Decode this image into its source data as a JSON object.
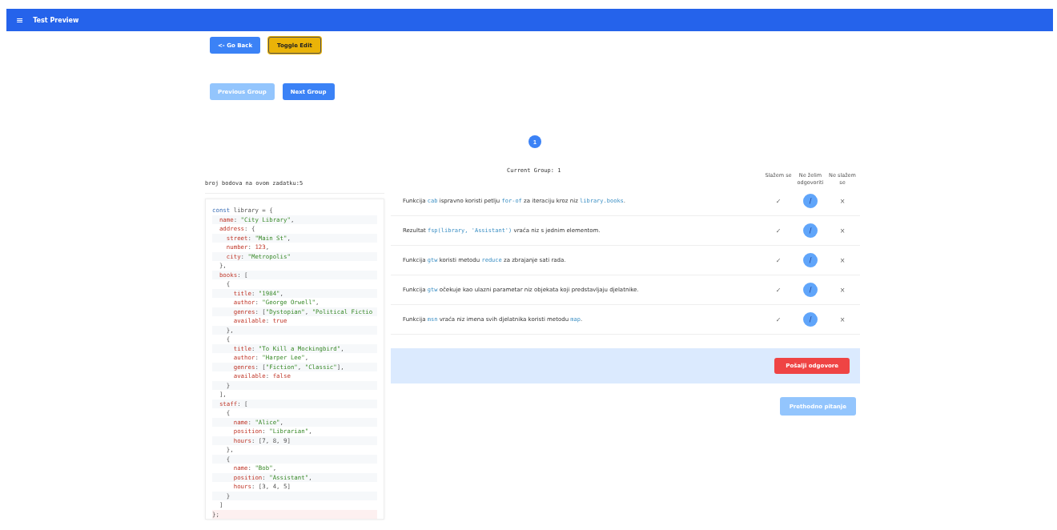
{
  "header": {
    "menu_icon": "≡",
    "title": "Test Preview"
  },
  "top_buttons": [
    {
      "label": "<- Go Back",
      "kind": "primary"
    },
    {
      "label": "Toggle Edit",
      "kind": "warning"
    }
  ],
  "group_nav": [
    {
      "label": "Previous Group",
      "disabled": true
    },
    {
      "label": "Next Group",
      "disabled": false
    }
  ],
  "pages": [
    {
      "label": "1",
      "selected": true
    }
  ],
  "current_group": "Current Group: 1",
  "points": "broj bodova na ovom zadatku:5",
  "code_lines": [
    [
      {
        "kind": "keyword",
        "text": "const "
      },
      {
        "kind": "plain",
        "text": "library = {"
      }
    ],
    [
      {
        "kind": "key",
        "text": "  name"
      },
      {
        "kind": "plain",
        "text": ": "
      },
      {
        "kind": "string",
        "text": "\"City Library\""
      },
      {
        "kind": "plain",
        "text": ","
      }
    ],
    [
      {
        "kind": "key",
        "text": "  address"
      },
      {
        "kind": "plain",
        "text": ": {"
      }
    ],
    [
      {
        "kind": "key",
        "text": "    street"
      },
      {
        "kind": "plain",
        "text": ": "
      },
      {
        "kind": "string",
        "text": "\"Main St\""
      },
      {
        "kind": "plain",
        "text": ","
      }
    ],
    [
      {
        "kind": "key",
        "text": "    number"
      },
      {
        "kind": "plain",
        "text": ": "
      },
      {
        "kind": "number",
        "text": "123"
      },
      {
        "kind": "plain",
        "text": ","
      }
    ],
    [
      {
        "kind": "key",
        "text": "    city"
      },
      {
        "kind": "plain",
        "text": ": "
      },
      {
        "kind": "string",
        "text": "\"Metropolis\""
      }
    ],
    [
      {
        "kind": "plain",
        "text": "  },"
      }
    ],
    [
      {
        "kind": "key",
        "text": "  books"
      },
      {
        "kind": "plain",
        "text": ": ["
      }
    ],
    [
      {
        "kind": "plain",
        "text": "    {"
      }
    ],
    [
      {
        "kind": "key",
        "text": "      title"
      },
      {
        "kind": "plain",
        "text": ": "
      },
      {
        "kind": "string",
        "text": "\"1984\""
      },
      {
        "kind": "plain",
        "text": ","
      }
    ],
    [
      {
        "kind": "key",
        "text": "      author"
      },
      {
        "kind": "plain",
        "text": ": "
      },
      {
        "kind": "string",
        "text": "\"George Orwell\""
      },
      {
        "kind": "plain",
        "text": ","
      }
    ],
    [
      {
        "kind": "key",
        "text": "      genres"
      },
      {
        "kind": "plain",
        "text": ": ["
      },
      {
        "kind": "string",
        "text": "\"Dystopian\""
      },
      {
        "kind": "plain",
        "text": ", "
      },
      {
        "kind": "string",
        "text": "\"Political Fictio"
      }
    ],
    [
      {
        "kind": "key",
        "text": "      available"
      },
      {
        "kind": "plain",
        "text": ": "
      },
      {
        "kind": "number",
        "text": "true"
      }
    ],
    [
      {
        "kind": "plain",
        "text": "    },"
      }
    ],
    [
      {
        "kind": "plain",
        "text": "    {"
      }
    ],
    [
      {
        "kind": "key",
        "text": "      title"
      },
      {
        "kind": "plain",
        "text": ": "
      },
      {
        "kind": "string",
        "text": "\"To Kill a Mockingbird\""
      },
      {
        "kind": "plain",
        "text": ","
      }
    ],
    [
      {
        "kind": "key",
        "text": "      author"
      },
      {
        "kind": "plain",
        "text": ": "
      },
      {
        "kind": "string",
        "text": "\"Harper Lee\""
      },
      {
        "kind": "plain",
        "text": ","
      }
    ],
    [
      {
        "kind": "key",
        "text": "      genres"
      },
      {
        "kind": "plain",
        "text": ": ["
      },
      {
        "kind": "string",
        "text": "\"Fiction\""
      },
      {
        "kind": "plain",
        "text": ", "
      },
      {
        "kind": "string",
        "text": "\"Classic\""
      },
      {
        "kind": "plain",
        "text": "],"
      }
    ],
    [
      {
        "kind": "key",
        "text": "      available"
      },
      {
        "kind": "plain",
        "text": ": "
      },
      {
        "kind": "number",
        "text": "false"
      }
    ],
    [
      {
        "kind": "plain",
        "text": "    }"
      }
    ],
    [
      {
        "kind": "plain",
        "text": "  ],"
      }
    ],
    [
      {
        "kind": "key",
        "text": "  staff"
      },
      {
        "kind": "plain",
        "text": ": ["
      }
    ],
    [
      {
        "kind": "plain",
        "text": "    {"
      }
    ],
    [
      {
        "kind": "key",
        "text": "      name"
      },
      {
        "kind": "plain",
        "text": ": "
      },
      {
        "kind": "string",
        "text": "\"Alice\""
      },
      {
        "kind": "plain",
        "text": ","
      }
    ],
    [
      {
        "kind": "key",
        "text": "      position"
      },
      {
        "kind": "plain",
        "text": ": "
      },
      {
        "kind": "string",
        "text": "\"Librarian\""
      },
      {
        "kind": "plain",
        "text": ","
      }
    ],
    [
      {
        "kind": "key",
        "text": "      hours"
      },
      {
        "kind": "plain",
        "text": ": [7, 8, 9]"
      }
    ],
    [
      {
        "kind": "plain",
        "text": "    },"
      }
    ],
    [
      {
        "kind": "plain",
        "text": "    {"
      }
    ],
    [
      {
        "kind": "key",
        "text": "      name"
      },
      {
        "kind": "plain",
        "text": ": "
      },
      {
        "kind": "string",
        "text": "\"Bob\""
      },
      {
        "kind": "plain",
        "text": ","
      }
    ],
    [
      {
        "kind": "key",
        "text": "      position"
      },
      {
        "kind": "plain",
        "text": ": "
      },
      {
        "kind": "string",
        "text": "\"Assistant\""
      },
      {
        "kind": "plain",
        "text": ","
      }
    ],
    [
      {
        "kind": "key",
        "text": "      hours"
      },
      {
        "kind": "plain",
        "text": ": [3, 4, 5]"
      }
    ],
    [
      {
        "kind": "plain",
        "text": "    }"
      }
    ],
    [
      {
        "kind": "plain",
        "text": "  ]"
      }
    ],
    [
      {
        "kind": "plain",
        "text": "};"
      }
    ]
  ],
  "answer_columns": [
    "Slažem se",
    "Ne želim odgovoriti",
    "Ne slažem se"
  ],
  "statements": [
    {
      "parts": [
        {
          "text": "Funkcija "
        },
        {
          "text": "cab",
          "code": true
        },
        {
          "text": " ispravno koristi petlju "
        },
        {
          "text": "for-of",
          "code": true
        },
        {
          "text": " za iteraciju kroz niz "
        },
        {
          "text": "library.books",
          "code": true
        },
        {
          "text": "."
        }
      ],
      "options": [
        {
          "symbol": "✓",
          "selected": false
        },
        {
          "symbol": "/",
          "selected": true
        },
        {
          "symbol": "×",
          "selected": false
        }
      ]
    },
    {
      "parts": [
        {
          "text": "Rezultat "
        },
        {
          "text": "fsp(library, 'Assistant')",
          "code": true
        },
        {
          "text": " vraća niz s jednim elementom."
        }
      ],
      "options": [
        {
          "symbol": "✓",
          "selected": false
        },
        {
          "symbol": "/",
          "selected": true
        },
        {
          "symbol": "×",
          "selected": false
        }
      ]
    },
    {
      "parts": [
        {
          "text": "Funkcija "
        },
        {
          "text": "gtw",
          "code": true
        },
        {
          "text": " koristi metodu "
        },
        {
          "text": "reduce",
          "code": true
        },
        {
          "text": " za zbrajanje sati rada."
        }
      ],
      "options": [
        {
          "symbol": "✓",
          "selected": false
        },
        {
          "symbol": "/",
          "selected": true
        },
        {
          "symbol": "×",
          "selected": false
        }
      ]
    },
    {
      "parts": [
        {
          "text": "Funkcija "
        },
        {
          "text": "gtw",
          "code": true
        },
        {
          "text": " očekuje kao ulazni parametar niz objekata koji predstavljaju djelatnike."
        }
      ],
      "options": [
        {
          "symbol": "✓",
          "selected": false
        },
        {
          "symbol": "/",
          "selected": true
        },
        {
          "symbol": "×",
          "selected": false
        }
      ]
    },
    {
      "parts": [
        {
          "text": "Funkcija "
        },
        {
          "text": "msn",
          "code": true
        },
        {
          "text": " vraća niz imena svih djelatnika koristi metodu "
        },
        {
          "text": "map",
          "code": true
        },
        {
          "text": "."
        }
      ],
      "options": [
        {
          "symbol": "✓",
          "selected": false
        },
        {
          "symbol": "/",
          "selected": true
        },
        {
          "symbol": "×",
          "selected": false
        }
      ]
    }
  ],
  "submit_button": "Pošalji odgovore",
  "previous_question": {
    "label": "Prethodno pitanje",
    "disabled": true
  }
}
